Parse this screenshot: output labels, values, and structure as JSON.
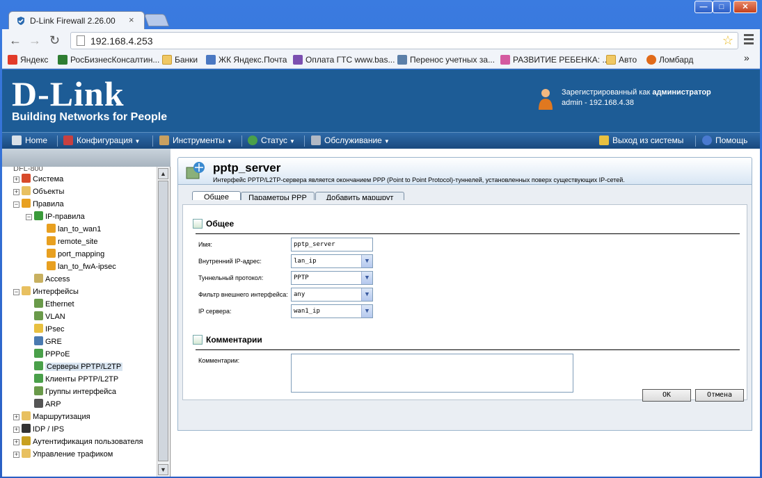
{
  "browser": {
    "tab_title": "D-Link Firewall 2.26.00",
    "tab_close": "×",
    "url": "192.168.4.253",
    "window_buttons": {
      "minimize": "—",
      "maximize": "□",
      "close": "✕"
    },
    "bookmarks": [
      {
        "label": "Яндекс",
        "icon": "yandex-icon",
        "color": "#e23b2a"
      },
      {
        "label": "РосБизнесКонсалтин...",
        "icon": "rbc-icon",
        "color": "#2e7d32"
      },
      {
        "label": "Банки",
        "icon": "folder-icon",
        "color": "#f0c864"
      },
      {
        "label": "ЖК Яндекс.Почта",
        "icon": "mail-icon",
        "color": "#4a78c2"
      },
      {
        "label": "Оплата ГТС www.bas...",
        "icon": "gts-icon",
        "color": "#7b4fb0"
      },
      {
        "label": "Перенос учетных за...",
        "icon": "doc-icon",
        "color": "#5b7fa8"
      },
      {
        "label": "РАЗВИТИЕ РЕБЕНКА: ...",
        "icon": "flower-icon",
        "color": "#d45aa0"
      },
      {
        "label": "Авто",
        "icon": "folder-icon",
        "color": "#f0c864"
      },
      {
        "label": "Ломбард",
        "icon": "lombard-icon",
        "color": "#e06a1a"
      }
    ],
    "bookmarks_more": "»"
  },
  "header": {
    "brand": "D-Link",
    "tagline": "Building Networks for People",
    "user_line1_prefix": "Зарегистрированный как ",
    "user_line1_role": "администратор",
    "user_line2": "admin - 192.168.4.38"
  },
  "nav": {
    "home": "Home",
    "config": "Конфигурация",
    "tools": "Инструменты",
    "status": "Статус",
    "maintenance": "Обслуживание",
    "logout": "Выход из системы",
    "help": "Помощь"
  },
  "tree": {
    "root_partial": "DFL-800",
    "items": [
      {
        "label": "Система",
        "exp": "+",
        "level": 0,
        "icon_color": "#d84a2a"
      },
      {
        "label": "Объекты",
        "exp": "+",
        "level": 0,
        "icon_color": "#e8c060"
      },
      {
        "label": "Правила",
        "exp": "−",
        "level": 0,
        "icon_color": "#e8a020"
      },
      {
        "label": "IP-правила",
        "exp": "−",
        "level": 1,
        "icon_color": "#3a9a3a"
      },
      {
        "label": "lan_to_wan1",
        "exp": "",
        "level": 2,
        "icon_color": "#e8a020"
      },
      {
        "label": "remote_site",
        "exp": "",
        "level": 2,
        "icon_color": "#e8a020"
      },
      {
        "label": "port_mapping",
        "exp": "",
        "level": 2,
        "icon_color": "#e8a020"
      },
      {
        "label": "lan_to_fwA-ipsec",
        "exp": "",
        "level": 2,
        "icon_color": "#e8a020"
      },
      {
        "label": "Access",
        "exp": "",
        "level": 1,
        "icon_color": "#c8b060"
      },
      {
        "label": "Интерфейсы",
        "exp": "−",
        "level": 0,
        "icon_color": "#e8c060"
      },
      {
        "label": "Ethernet",
        "exp": "",
        "level": 1,
        "icon_color": "#6a9a4a"
      },
      {
        "label": "VLAN",
        "exp": "",
        "level": 1,
        "icon_color": "#6a9a4a"
      },
      {
        "label": "IPsec",
        "exp": "",
        "level": 1,
        "icon_color": "#e8c040"
      },
      {
        "label": "GRE",
        "exp": "",
        "level": 1,
        "icon_color": "#4a7ab0"
      },
      {
        "label": "PPPoE",
        "exp": "",
        "level": 1,
        "icon_color": "#4aa04a"
      },
      {
        "label": "Серверы PPTP/L2TP",
        "exp": "",
        "level": 1,
        "icon_color": "#4aa04a",
        "selected": true
      },
      {
        "label": "Клиенты PPTP/L2TP",
        "exp": "",
        "level": 1,
        "icon_color": "#4aa04a"
      },
      {
        "label": "Группы интерфейса",
        "exp": "",
        "level": 1,
        "icon_color": "#6a9a4a"
      },
      {
        "label": "ARP",
        "exp": "",
        "level": 1,
        "icon_color": "#555555"
      },
      {
        "label": "Маршрутизация",
        "exp": "+",
        "level": 0,
        "icon_color": "#e8c060"
      },
      {
        "label": "IDP / IPS",
        "exp": "+",
        "level": 0,
        "icon_color": "#333333"
      },
      {
        "label": "Аутентификация пользователя",
        "exp": "+",
        "level": 0,
        "icon_color": "#c8a020"
      },
      {
        "label": "Управление трафиком",
        "exp": "+",
        "level": 0,
        "icon_color": "#e8c060"
      }
    ]
  },
  "panel": {
    "title": "pptp_server",
    "description": "Интерфейс PPTP/L2TP-сервера является окончанием PPP (Point to Point Protocol)-туннелей, установленных поверх существующих IP-сетей.",
    "tabs": [
      "Общее",
      "Параметры PPP",
      "Добавить маршрут"
    ],
    "section_general": "Общее",
    "fields": [
      {
        "label": "Имя:",
        "value": "pptp_server",
        "type": "input"
      },
      {
        "label": "Внутренний IP-адрес:",
        "value": "lan_ip",
        "type": "select"
      },
      {
        "label": "Туннельный протокол:",
        "value": "PPTP",
        "type": "select"
      },
      {
        "label": "Фильтр внешнего интерфейса:",
        "value": "any",
        "type": "select"
      },
      {
        "label": "IP сервера:",
        "value": "wan1_ip",
        "type": "select"
      }
    ],
    "section_comments": "Комментарии",
    "comments_label": "Комментарии:",
    "comments_value": "",
    "ok": "OK",
    "cancel": "Отмена"
  },
  "colors": {
    "banner": "#1d5c96",
    "navbar": "#19497e",
    "window_frame": "#2a5fc4"
  }
}
